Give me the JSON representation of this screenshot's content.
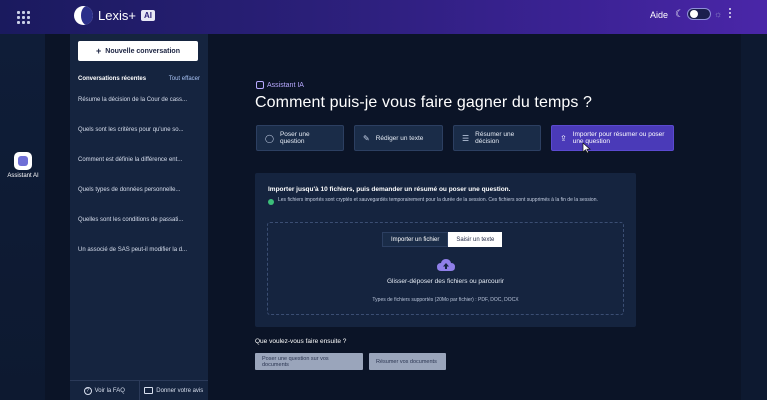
{
  "topbar": {
    "brand": "Lexis+",
    "brand_badge": "AI",
    "help_label": "Aide"
  },
  "rail": {
    "assistant_label": "Assistant AI"
  },
  "chat_panel": {
    "new_conversation_label": "Nouvelle conversation",
    "recent_title": "Conversations récentes",
    "clear_all_label": "Tout effacer",
    "conversations": [
      "Résume la décision de la Cour de cass...",
      "Quels sont les critères pour qu'une so...",
      "Comment est définie la différence ent...",
      "Quels types de données personnelle...",
      "Quelles sont les conditions de passati...",
      "Un associé de SAS peut-il modifier la d..."
    ],
    "faq_label": "Voir la FAQ",
    "feedback_label": "Donner votre avis"
  },
  "main": {
    "assistant_tag": "Assistant IA",
    "title": "Comment puis-je vous faire gagner du temps ?",
    "actions": [
      {
        "label": "Poser une question",
        "icon": "chat-icon"
      },
      {
        "label": "Rédiger un texte",
        "icon": "edit-icon"
      },
      {
        "label": "Résumer une décision",
        "icon": "list-icon"
      },
      {
        "label": "Importer pour résumer ou poser une question",
        "icon": "upload-icon"
      }
    ],
    "upload": {
      "title": "Importer jusqu'à 10 fichiers, puis demander un résumé ou poser une question.",
      "note": "Les fichiers importés sont cryptés et sauvegardés temporairement pour la durée de la session. Ces fichiers sont supprimés à la fin de la session.",
      "tab_import": "Importer un fichier",
      "tab_text": "Saisir un texte",
      "drop_label": "Glisser-déposer des fichiers ou parcourir",
      "file_types": "Types de fichiers supportés (20Mo par fichier) : PDF, DOC, DOCX"
    },
    "next_title": "Que voulez-vous faire ensuite ?",
    "next_actions": [
      "Poser une question sur vos documents",
      "Résumer vos documents"
    ]
  },
  "colors": {
    "accent": "#4a3ab8",
    "background": "#0b1427",
    "panel": "#15243f"
  }
}
